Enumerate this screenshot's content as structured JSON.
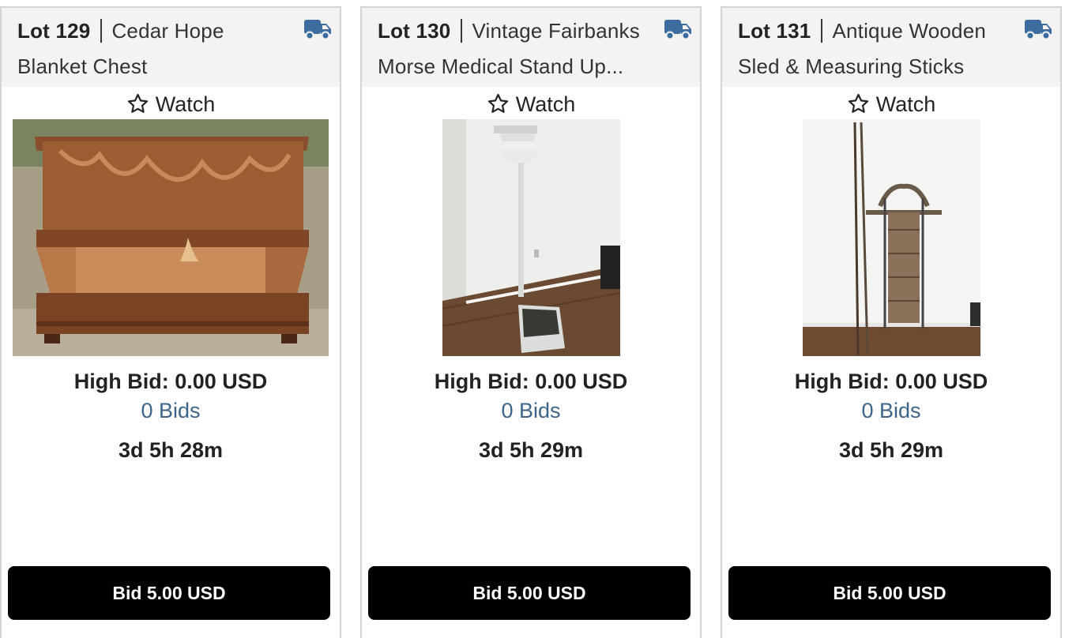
{
  "lots": [
    {
      "lot_label": "Lot 129",
      "title_line1": "Cedar Hope",
      "title_line2": "Blanket Chest",
      "watch_label": "Watch",
      "high_bid": "High Bid: 0.00 USD",
      "bids": "0 Bids",
      "time_left": "3d 5h 28m",
      "bid_button": "Bid 5.00 USD"
    },
    {
      "lot_label": "Lot 130",
      "title_line1": "Vintage Fairbanks",
      "title_line2": "Morse Medical Stand Up...",
      "watch_label": "Watch",
      "high_bid": "High Bid: 0.00 USD",
      "bids": "0 Bids",
      "time_left": "3d 5h 29m",
      "bid_button": "Bid 5.00 USD"
    },
    {
      "lot_label": "Lot 131",
      "title_line1": "Antique Wooden",
      "title_line2": "Sled & Measuring Sticks",
      "watch_label": "Watch",
      "high_bid": "High Bid: 0.00 USD",
      "bids": "0 Bids",
      "time_left": "3d 5h 29m",
      "bid_button": "Bid 5.00 USD"
    }
  ],
  "icons": {
    "shipping": "truck-icon",
    "watch": "star-outline-icon"
  },
  "colors": {
    "shipping_icon": "#3d6c9e",
    "bids_link": "#3c6489",
    "bid_button_bg": "#000000",
    "header_bg": "#f3f3f3"
  }
}
